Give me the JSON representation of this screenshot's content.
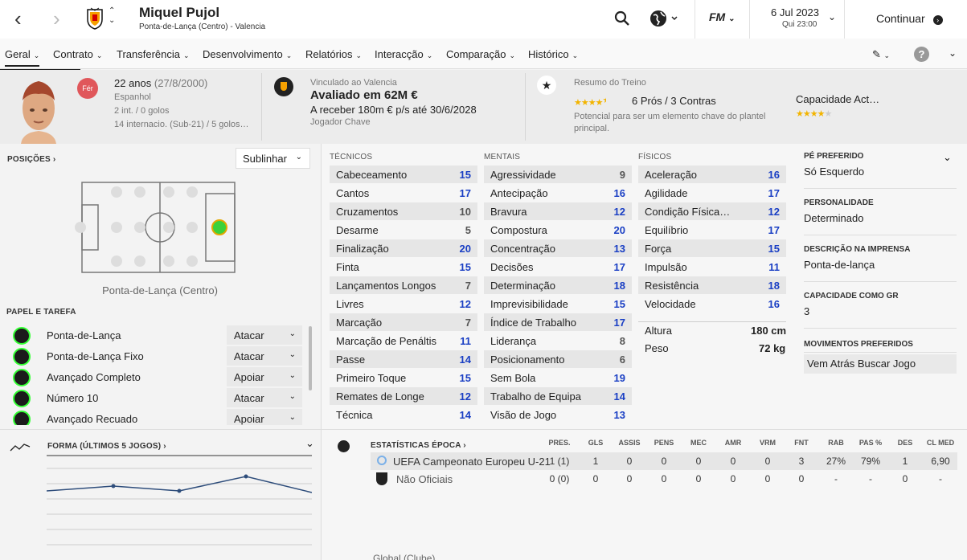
{
  "header": {
    "name": "Miquel Pujol",
    "subtitle": "Ponta-de-Lança (Centro) - Valencia",
    "date": "6 Jul 2023",
    "time": "Qui 23:00",
    "continue": "Continuar",
    "fm": "FM"
  },
  "menu": [
    {
      "label": "Geral"
    },
    {
      "label": "Contrato"
    },
    {
      "label": "Transferência"
    },
    {
      "label": "Desenvolvimento"
    },
    {
      "label": "Relatórios"
    },
    {
      "label": "Interacção"
    },
    {
      "label": "Comparação"
    },
    {
      "label": "Histórico"
    }
  ],
  "profile": {
    "badge": "Fér",
    "age": "22 anos",
    "dob": "(27/8/2000)",
    "nationality": "Espanhol",
    "caps": "2 int. / 0 golos",
    "youth": "14 internacio. (Sub-21) / 5 golos…",
    "contract_label": "Vinculado ao Valencia",
    "value": "Avaliado em 62M €",
    "wage": "A receber 180m € p/s até 30/6/2028",
    "status": "Jogador Chave",
    "training_label": "Resumo do Treino",
    "pros_cons": "6 Prós / 3 Contras",
    "potential": "Potencial para ser um elemento chave do plantel principal.",
    "ability_label": "Capacidade Act…",
    "training_stars": 4.5,
    "ability_stars": 4
  },
  "positions": {
    "title": "POSIÇÕES ›",
    "highlight": "Sublinhar",
    "current": "Ponta-de-Lança (Centro)"
  },
  "roles": {
    "title": "PAPEL E TAREFA",
    "items": [
      {
        "name": "Ponta-de-Lança",
        "duty": "Atacar"
      },
      {
        "name": "Ponta-de-Lança Fixo",
        "duty": "Atacar"
      },
      {
        "name": "Avançado Completo",
        "duty": "Apoiar"
      },
      {
        "name": "Número 10",
        "duty": "Atacar"
      },
      {
        "name": "Avançado Recuado",
        "duty": "Apoiar"
      }
    ]
  },
  "attributes": {
    "tech_title": "TÉCNICOS",
    "mental_title": "MENTAIS",
    "phys_title": "FÍSICOS",
    "technical": [
      [
        "Cabeceamento",
        "15"
      ],
      [
        "Cantos",
        "17"
      ],
      [
        "Cruzamentos",
        "10"
      ],
      [
        "Desarme",
        "5"
      ],
      [
        "Finalização",
        "20"
      ],
      [
        "Finta",
        "15"
      ],
      [
        "Lançamentos Longos",
        "7"
      ],
      [
        "Livres",
        "12"
      ],
      [
        "Marcação",
        "7"
      ],
      [
        "Marcação de Penáltis",
        "11"
      ],
      [
        "Passe",
        "14"
      ],
      [
        "Primeiro Toque",
        "15"
      ],
      [
        "Remates de Longe",
        "12"
      ],
      [
        "Técnica",
        "14"
      ]
    ],
    "mental": [
      [
        "Agressividade",
        "9"
      ],
      [
        "Antecipação",
        "16"
      ],
      [
        "Bravura",
        "12"
      ],
      [
        "Compostura",
        "20"
      ],
      [
        "Concentração",
        "13"
      ],
      [
        "Decisões",
        "17"
      ],
      [
        "Determinação",
        "18"
      ],
      [
        "Imprevisibilidade",
        "15"
      ],
      [
        "Índice de Trabalho",
        "17"
      ],
      [
        "Liderança",
        "8"
      ],
      [
        "Posicionamento",
        "6"
      ],
      [
        "Sem Bola",
        "19"
      ],
      [
        "Trabalho de Equipa",
        "14"
      ],
      [
        "Visão de Jogo",
        "13"
      ]
    ],
    "physical": [
      [
        "Aceleração",
        "16"
      ],
      [
        "Agilidade",
        "17"
      ],
      [
        "Condição Física…",
        "12"
      ],
      [
        "Equilíbrio",
        "17"
      ],
      [
        "Força",
        "15"
      ],
      [
        "Impulsão",
        "11"
      ],
      [
        "Resistência",
        "18"
      ],
      [
        "Velocidade",
        "16"
      ]
    ],
    "height_label": "Altura",
    "height": "180 cm",
    "weight_label": "Peso",
    "weight": "72 kg"
  },
  "info": [
    {
      "label": "PÉ PREFERIDO",
      "value": "Só Esquerdo"
    },
    {
      "label": "PERSONALIDADE",
      "value": "Determinado"
    },
    {
      "label": "DESCRIÇÃO NA IMPRENSA",
      "value": "Ponta-de-lança"
    },
    {
      "label": "CAPACIDADE COMO GR",
      "value": "3"
    },
    {
      "label": "MOVIMENTOS PREFERIDOS",
      "value": "Vem Atrás Buscar Jogo"
    }
  ],
  "form": {
    "title": "FORMA (ÚLTIMOS 5 JOGOS) ›"
  },
  "stats": {
    "title": "ESTATÍSTICAS ÉPOCA ›",
    "cols": [
      "PRES.",
      "GLS",
      "ASSIS",
      "PENS",
      "MEC",
      "AMR",
      "VRM",
      "FNT",
      "RAB",
      "PAS %",
      "DES",
      "CL MED"
    ],
    "rows": [
      {
        "comp": "UEFA Campeonato Europeu U-21",
        "vals": [
          "1 (1)",
          "1",
          "0",
          "0",
          "0",
          "0",
          "0",
          "3",
          "27%",
          "79%",
          "1",
          "6,90"
        ]
      },
      {
        "comp": "Não Oficiais",
        "vals": [
          "0 (0)",
          "0",
          "0",
          "0",
          "0",
          "0",
          "0",
          "0",
          "-",
          "-",
          "0",
          "-"
        ]
      }
    ],
    "footer": "Global (Clube)"
  },
  "colors": {
    "accent_blue": "#1a3fc4",
    "badge_red": "#e0575b",
    "star_gold": "#f2b400"
  }
}
